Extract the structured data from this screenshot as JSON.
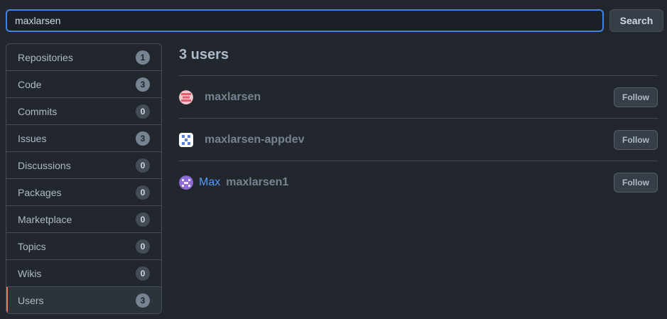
{
  "search": {
    "value": "maxlarsen",
    "button_label": "Search"
  },
  "sidebar": {
    "items": [
      {
        "label": "Repositories",
        "count": "1"
      },
      {
        "label": "Code",
        "count": "3"
      },
      {
        "label": "Commits",
        "count": "0"
      },
      {
        "label": "Issues",
        "count": "3"
      },
      {
        "label": "Discussions",
        "count": "0"
      },
      {
        "label": "Packages",
        "count": "0"
      },
      {
        "label": "Marketplace",
        "count": "0"
      },
      {
        "label": "Topics",
        "count": "0"
      },
      {
        "label": "Wikis",
        "count": "0"
      },
      {
        "label": "Users",
        "count": "3"
      }
    ],
    "selected": "Users"
  },
  "results": {
    "title": "3 users",
    "users": [
      {
        "display_name": "",
        "login": "maxlarsen",
        "follow_label": "Follow",
        "avatar_color": "#e05d6f"
      },
      {
        "display_name": "",
        "login": "maxlarsen-appdev",
        "follow_label": "Follow",
        "avatar_color": "#5a7fd6"
      },
      {
        "display_name": "Max",
        "login": "maxlarsen1",
        "follow_label": "Follow",
        "avatar_color": "#8e6bd8"
      }
    ]
  },
  "colors": {
    "accent": "#4184e4",
    "selected_marker": "#ec775c",
    "link": "#539bf5"
  }
}
